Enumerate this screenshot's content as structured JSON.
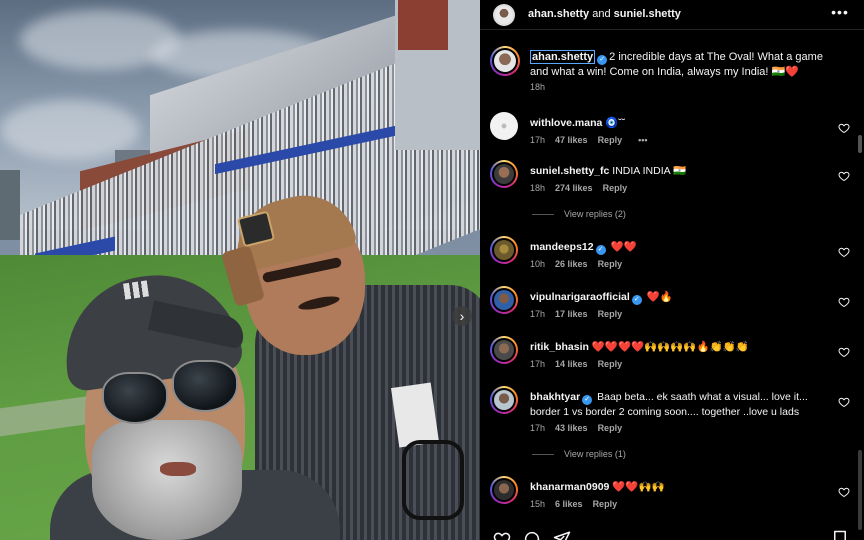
{
  "header": {
    "user1": "ahan.shetty",
    "joiner": "and",
    "user2": "suniel.shetty",
    "more_label": "•••"
  },
  "caption": {
    "username": "ahan.shetty",
    "text": "2 incredible days at The Oval! What a game and what a win! Come on India, always my India! 🇮🇳❤️",
    "time": "18h"
  },
  "comments": [
    {
      "username": "withlove.mana",
      "text": "🧿˘˘",
      "time": "17h",
      "likes": "47 likes",
      "reply": "Reply",
      "more": "•••",
      "verified": false
    },
    {
      "username": "suniel.shetty_fc",
      "text": "INDIA INDIA 🇮🇳",
      "time": "18h",
      "likes": "274 likes",
      "reply": "Reply",
      "verified": false,
      "view_replies": "View replies (2)"
    },
    {
      "username": "mandeeps12",
      "text": "❤️❤️",
      "time": "10h",
      "likes": "26 likes",
      "reply": "Reply",
      "verified": true
    },
    {
      "username": "vipulnarigaraofficial",
      "text": "❤️🔥",
      "time": "17h",
      "likes": "17 likes",
      "reply": "Reply",
      "verified": true
    },
    {
      "username": "ritik_bhasin",
      "text": "❤️❤️❤️❤️🙌🙌🙌🙌🔥👏👏👏",
      "time": "17h",
      "likes": "14 likes",
      "reply": "Reply",
      "verified": false
    },
    {
      "username": "bhakhtyar",
      "text": "Baap beta... ek saath what a visual... love it... border 1 vs border 2 coming soon.... together ..love u lads",
      "time": "17h",
      "likes": "43 likes",
      "reply": "Reply",
      "verified": true,
      "view_replies": "View replies (1)"
    },
    {
      "username": "khanarman0909",
      "text": "❤️❤️🙌🙌",
      "time": "15h",
      "likes": "6 likes",
      "reply": "Reply",
      "verified": false
    }
  ],
  "photo": {
    "next_arrow": "›"
  },
  "icons": {
    "more": "more-icon",
    "heart": "heart-icon",
    "comment": "comment-icon",
    "share": "share-icon",
    "save": "save-icon",
    "verified": "verified-badge-icon",
    "next": "chevron-right-icon"
  },
  "colors": {
    "background": "#000000",
    "text": "#f5f5f5",
    "muted": "#a8a8a8",
    "verified": "#3897f0"
  }
}
